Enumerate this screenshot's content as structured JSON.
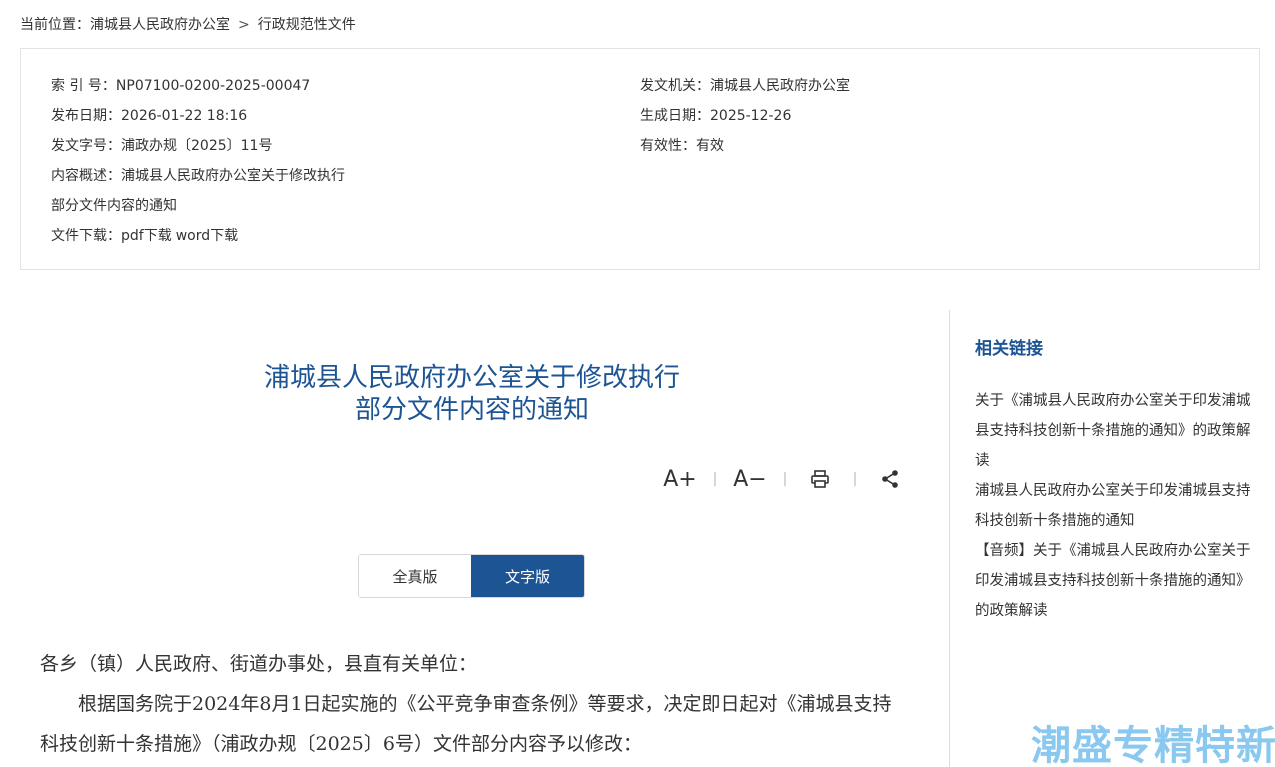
{
  "breadcrumb": {
    "prefix": "当前位置：",
    "items": [
      "浦城县人民政府办公室",
      "行政规范性文件"
    ],
    "separator": ">"
  },
  "meta": {
    "left": [
      {
        "label": "索 引 号：",
        "value": "NP07100-0200-2025-00047"
      },
      {
        "label": "发布日期：",
        "value": "2026-01-22 18:16"
      },
      {
        "label": "发文字号：",
        "value": "浦政办规〔2025〕11号"
      },
      {
        "label": "内容概述：",
        "value": "浦城县人民政府办公室关于修改执行"
      },
      {
        "label": "",
        "value": "部分文件内容的通知"
      },
      {
        "label": "文件下载：",
        "links": [
          "pdf下载",
          "word下载"
        ]
      }
    ],
    "right": [
      {
        "label": "发文机关：",
        "value": "浦城县人民政府办公室"
      },
      {
        "label": "生成日期：",
        "value": "2025-12-26"
      },
      {
        "label": "有效性：",
        "value": "有效"
      }
    ]
  },
  "document": {
    "title_line1": "浦城县人民政府办公室关于修改执行",
    "title_line2": "部分文件内容的通知",
    "tools": {
      "font_increase": "A+",
      "font_decrease": "A−",
      "separator": "|"
    },
    "versions": {
      "full": "全真版",
      "text": "文字版",
      "active": "text"
    },
    "salutation": "各乡（镇）人民政府、街道办事处，县直有关单位：",
    "paragraph1": "根据国务院于2024年8月1日起实施的《公平竞争审查条例》等要求，决定即日起对《浦城县支持科技创新十条措施》（浦政办规〔2025〕6号）文件部分内容予以修改："
  },
  "sidebar": {
    "title": "相关链接",
    "links": [
      "关于《浦城县人民政府办公室关于印发浦城县支持科技创新十条措施的通知》的政策解读",
      "浦城县人民政府办公室关于印发浦城县支持科技创新十条措施的通知",
      "【音频】关于《浦城县人民政府办公室关于印发浦城县支持科技创新十条措施的通知》的政策解读"
    ]
  },
  "watermark": "潮盛专精特新",
  "colors": {
    "accent": "#1d5494",
    "watermark": "#7ec3ee"
  }
}
